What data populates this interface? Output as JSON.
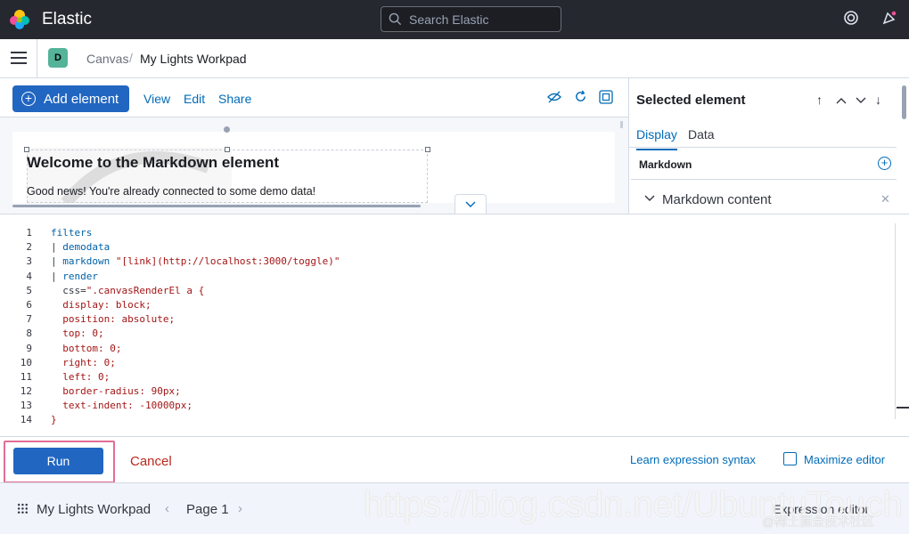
{
  "header": {
    "brand": "Elastic",
    "search_placeholder": "Search Elastic"
  },
  "breadcrumbs": {
    "space_initial": "D",
    "items": [
      "Canvas",
      "My Lights Workpad"
    ]
  },
  "toolbar": {
    "add_element": "Add element",
    "links": [
      "View",
      "Edit",
      "Share"
    ]
  },
  "canvas": {
    "md_title": "Welcome to the Markdown element",
    "md_body": "Good news! You're already connected to some demo data!"
  },
  "sidebar": {
    "title": "Selected element",
    "tabs": [
      "Display",
      "Data"
    ],
    "section": "Markdown",
    "subsection": "Markdown content"
  },
  "editor": {
    "lines": [
      [
        {
          "t": "filters",
          "c": "k"
        }
      ],
      [
        {
          "t": "| ",
          "c": "p"
        },
        {
          "t": "demodata",
          "c": "k"
        }
      ],
      [
        {
          "t": "| ",
          "c": "p"
        },
        {
          "t": "markdown ",
          "c": "k"
        },
        {
          "t": "\"[link](http://localhost:3000/toggle)\"",
          "c": "s"
        }
      ],
      [
        {
          "t": "| ",
          "c": "p"
        },
        {
          "t": "render",
          "c": "k"
        }
      ],
      [
        {
          "t": "  css=",
          "c": "p"
        },
        {
          "t": "\".canvasRenderEl a {",
          "c": "s"
        }
      ],
      [
        {
          "t": "  display: block;",
          "c": "s"
        }
      ],
      [
        {
          "t": "  position: absolute;",
          "c": "s"
        }
      ],
      [
        {
          "t": "  top: 0;",
          "c": "s"
        }
      ],
      [
        {
          "t": "  bottom: 0;",
          "c": "s"
        }
      ],
      [
        {
          "t": "  right: 0;",
          "c": "s"
        }
      ],
      [
        {
          "t": "  left: 0;",
          "c": "s"
        }
      ],
      [
        {
          "t": "  border-radius: 90px;",
          "c": "s"
        }
      ],
      [
        {
          "t": "  text-indent: -10000px;",
          "c": "s"
        }
      ],
      [
        {
          "t": "}",
          "c": "s"
        }
      ]
    ]
  },
  "footer": {
    "run": "Run",
    "cancel": "Cancel",
    "learn": "Learn expression syntax",
    "maximize": "Maximize editor"
  },
  "bottom": {
    "workpad": "My Lights Workpad",
    "page": "Page 1",
    "expression_editor": "Expression editor"
  },
  "watermark": {
    "url": "https://blog.csdn.net/UbuntuTouch",
    "credit": "@稀土掘金技术社区"
  }
}
